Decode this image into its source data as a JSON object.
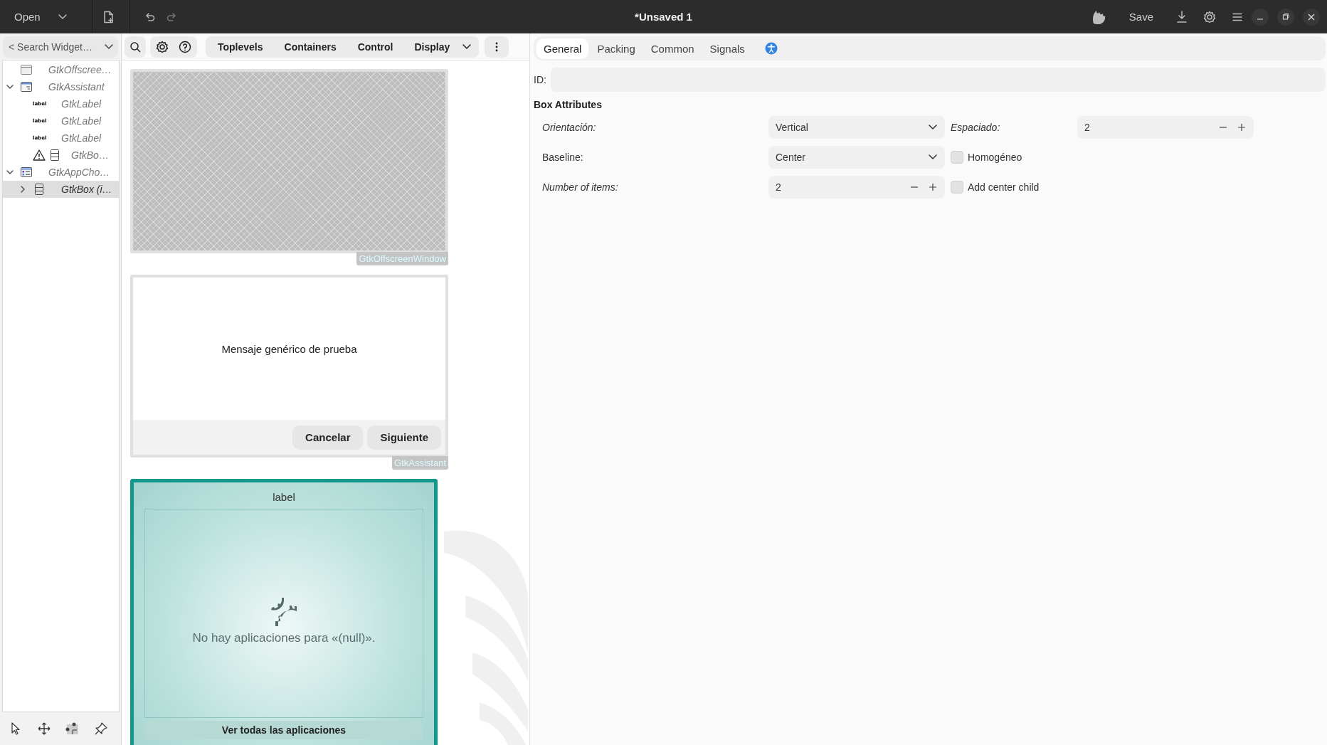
{
  "header": {
    "open_button": "Open",
    "title": "*Unsaved 1",
    "save_button": "Save"
  },
  "sidebar": {
    "search": {
      "placeholder": "< Search Widget…"
    },
    "tree": [
      {
        "text": "GtkOffscree…",
        "kind": "window",
        "selected": false
      },
      {
        "text": "GtkAssistant",
        "kind": "assistant",
        "selected": false,
        "expanded": true,
        "children": [
          {
            "text": "GtkLabel",
            "kind": "label",
            "badge": "label",
            "selected": false
          },
          {
            "text": "GtkLabel",
            "kind": "label",
            "badge": "label",
            "selected": false
          },
          {
            "text": "GtkLabel",
            "kind": "label",
            "badge": "label",
            "selected": false
          },
          {
            "text": "GtkBo…",
            "kind": "box",
            "warning": true,
            "selected": false
          }
        ]
      },
      {
        "text": "GtkAppCho…",
        "kind": "app_chooser",
        "selected": false,
        "expanded": true,
        "children": [
          {
            "text": "GtkBox (i…",
            "kind": "box",
            "selected": true,
            "expanded": false
          }
        ]
      }
    ]
  },
  "palette": {
    "categories": [
      {
        "label": "Toplevels"
      },
      {
        "label": "Containers"
      },
      {
        "label": "Control"
      },
      {
        "label": "Display"
      }
    ]
  },
  "canvas": {
    "widgets": [
      {
        "kind": "offscreen",
        "caption": "GtkOffscreenWindow"
      },
      {
        "kind": "assistant",
        "message": "Mensaje genérico de prueba",
        "buttons": [
          "Cancelar",
          "Siguiente"
        ],
        "caption": "GtkAssistant"
      },
      {
        "kind": "app_chooser",
        "title": "label",
        "message": "No hay aplicaciones para «(null)».",
        "button": "Ver todas las aplicaciones"
      }
    ]
  },
  "properties": {
    "tabs": [
      {
        "label": "General",
        "selected": true
      },
      {
        "label": "Packing",
        "selected": false
      },
      {
        "label": "Common",
        "selected": false
      },
      {
        "label": "Signals",
        "selected": false
      }
    ],
    "id_label": "ID:",
    "section": "Box Attributes",
    "rows": [
      [
        {
          "kind": "dropdown",
          "label": "Orientación:",
          "italic": true,
          "value": "Vertical"
        },
        {
          "kind": "spin",
          "label": "Espaciado:",
          "italic": true,
          "value": "2"
        }
      ],
      [
        {
          "kind": "dropdown",
          "label": "Baseline:",
          "italic": false,
          "value": "Center"
        },
        {
          "kind": "checkbox",
          "label": "Homogéneo",
          "checked": false
        }
      ],
      [
        {
          "kind": "spin",
          "label": "Number of items:",
          "italic": true,
          "value": "2"
        },
        {
          "kind": "checkbox",
          "label": "Add center child",
          "checked": false
        }
      ]
    ]
  }
}
